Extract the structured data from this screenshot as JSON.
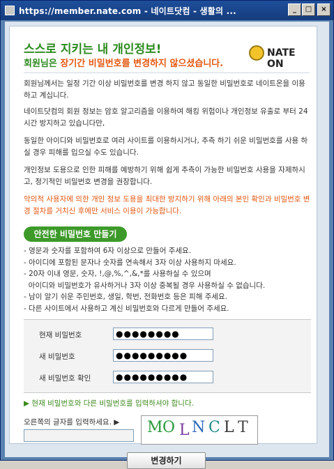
{
  "window": {
    "title": "https://member.nate.com - 네이트닷컴 - 생활의 ...",
    "controls": [
      "_",
      "□",
      "×"
    ]
  },
  "header": {
    "title": "스스로 지키는 내 개인정보!",
    "subtitle_prefix": "회원님은 ",
    "subtitle_highlight": "장기간 비밀번호를 변경하지 않으셨습니다.",
    "logo_text": "NATE ON"
  },
  "body": {
    "paragraphs": [
      "회원님께서는 일정 기간 이상 비밀번호를 변경 하지 않고 동일한 비밀번호로 네이트온을 이용하고 계십니다.",
      "네이트닷컴의 회원 정보는 암호 알고리즘을 이용하여 해킹 위험이나 개인정보 유출로 부터 24시간 방지하고 있습니다만,",
      "동일한 아이디와 비밀번호로 여러 사이트를 이용하시거나, 추측 하기 쉬운 비밀번호를 사용 하실 경우 피해를 입으실 수도 있습니다.",
      "개인정보 도용으로 인한 피해를 예방하기 위해 쉽게 추측이 가능한 비밀번호 사용을 자제하시고, 정기적인 비밀번호 변경을 권장합니다."
    ],
    "warning": "악의적 사용자에 의한 개인 정보 도용을 최대한 방지하기 위해 아래의 본인 확인과 비밀번호 변경 절차를 거치신 후에만 서비스 이용이 가능합니다."
  },
  "section": {
    "pill_label": "안전한 비밀번호 만들기",
    "rules": [
      "- 영문과 숫자를 포함하여 6자 이상으로 만들어 주세요.",
      "- 아이디에 포함된 문자나 숫자를 연속해서 3자 이상 사용하지 마세요.",
      "- 20자 이내 영문, 숫자, !,@,%,^,&,*를 사용하실 수 있으며",
      "  아이디와 비밀번호가 유사하거나 3자 이상 중복될 경우 사용하실 수 없습니다.",
      "- 남이 알기 쉬운 주민번호, 생일, 학번, 전화번호 등은 피해 주세요.",
      "- 다른 사이트에서 사용하고 계신 비밀번호와 다르게 만들어 주세요."
    ]
  },
  "form": {
    "current_label": "현재 비밀번호",
    "current_value": "●●●●●●●●",
    "new_label": "새 비밀번호",
    "new_value": "●●●●●●●●●",
    "confirm_label": "새 비밀번호 확인",
    "confirm_value": "●●●●●●●●●"
  },
  "notice": "▶ 현재 비밀번호와 다른 비밀번호를 입력하셔야 합니다.",
  "captcha": {
    "label": "오른쪽의 글자를 입력하세요. ▶",
    "input_value": "",
    "chars": [
      "M",
      "O",
      "L",
      "N",
      "C",
      "L",
      "T"
    ]
  },
  "submit_label": "변경하기"
}
